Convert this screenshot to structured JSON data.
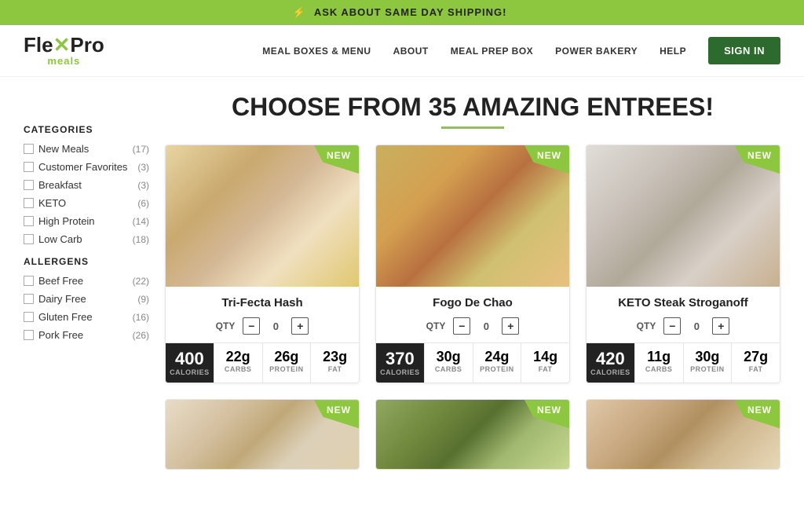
{
  "banner": {
    "icon": "⚡",
    "text": "ASK ABOUT SAME DAY SHIPPING!"
  },
  "header": {
    "logo": {
      "flex": "Fle",
      "x": "x",
      "pro": "Pro",
      "meals": "meals"
    },
    "nav": [
      {
        "label": "MEAL BOXES & MENU",
        "id": "meal-boxes"
      },
      {
        "label": "ABOUT",
        "id": "about"
      },
      {
        "label": "MEAL PREP BOX",
        "id": "meal-prep"
      },
      {
        "label": "POWER BAKERY",
        "id": "power-bakery"
      },
      {
        "label": "HELP",
        "id": "help"
      }
    ],
    "signin": "SIGN IN"
  },
  "sidebar": {
    "categories_title": "CATEGORIES",
    "categories": [
      {
        "label": "New Meals",
        "count": 17
      },
      {
        "label": "Customer Favorites",
        "count": 3
      },
      {
        "label": "Breakfast",
        "count": 3
      },
      {
        "label": "KETO",
        "count": 6
      },
      {
        "label": "High Protein",
        "count": 14
      },
      {
        "label": "Low Carb",
        "count": 18
      }
    ],
    "allergens_title": "ALLERGENS",
    "allergens": [
      {
        "label": "Beef Free",
        "count": 22
      },
      {
        "label": "Dairy Free",
        "count": 9
      },
      {
        "label": "Gluten Free",
        "count": 16
      },
      {
        "label": "Pork Free",
        "count": 26
      }
    ]
  },
  "page_title": "CHOOSE FROM 35 AMAZING ENTREES!",
  "meals": [
    {
      "id": "tri-fecta",
      "name": "Tri-Fecta Hash",
      "new": true,
      "qty": 0,
      "img_class": "food-img-1",
      "calories": "400",
      "carbs": "22g",
      "protein": "26g",
      "fat": "23g"
    },
    {
      "id": "fogo-de-chao",
      "name": "Fogo De Chao",
      "new": true,
      "qty": 0,
      "img_class": "food-img-2",
      "calories": "370",
      "carbs": "30g",
      "protein": "24g",
      "fat": "14g"
    },
    {
      "id": "keto-steak",
      "name": "KETO Steak Stroganoff",
      "new": true,
      "qty": 0,
      "img_class": "food-img-3",
      "calories": "420",
      "carbs": "11g",
      "protein": "30g",
      "fat": "27g"
    }
  ],
  "partial_meals": [
    {
      "id": "p1",
      "img_class": "food-img-4",
      "new": true
    },
    {
      "id": "p2",
      "img_class": "food-img-5",
      "new": true
    },
    {
      "id": "p3",
      "img_class": "food-img-6",
      "new": true
    }
  ],
  "labels": {
    "qty": "QTY",
    "calories": "CALORIES",
    "carbs": "CARBS",
    "protein": "PROTEIN",
    "fat": "FAT",
    "new": "NEW"
  }
}
